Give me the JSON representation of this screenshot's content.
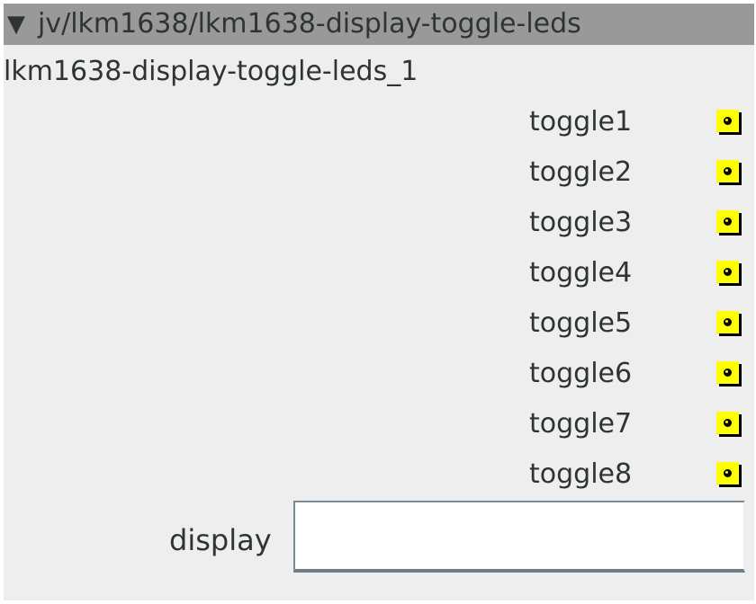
{
  "header": {
    "collapse_glyph": "▼",
    "path": "jv/lkm1638/lkm1638-display-toggle-leds"
  },
  "instance": {
    "label": "lkm1638-display-toggle-leds_1"
  },
  "toggles": [
    {
      "label": "toggle1",
      "icon": "led-toggle-icon"
    },
    {
      "label": "toggle2",
      "icon": "led-toggle-icon"
    },
    {
      "label": "toggle3",
      "icon": "led-toggle-icon"
    },
    {
      "label": "toggle4",
      "icon": "led-toggle-icon"
    },
    {
      "label": "toggle5",
      "icon": "led-toggle-icon"
    },
    {
      "label": "toggle6",
      "icon": "led-toggle-icon"
    },
    {
      "label": "toggle7",
      "icon": "led-toggle-icon"
    },
    {
      "label": "toggle8",
      "icon": "led-toggle-icon"
    }
  ],
  "display": {
    "label": "display",
    "value": ""
  },
  "colors": {
    "header_bg": "#999999",
    "panel_bg": "#eeeeee",
    "toggle_face": "#ffff00",
    "text": "#2e3436"
  }
}
